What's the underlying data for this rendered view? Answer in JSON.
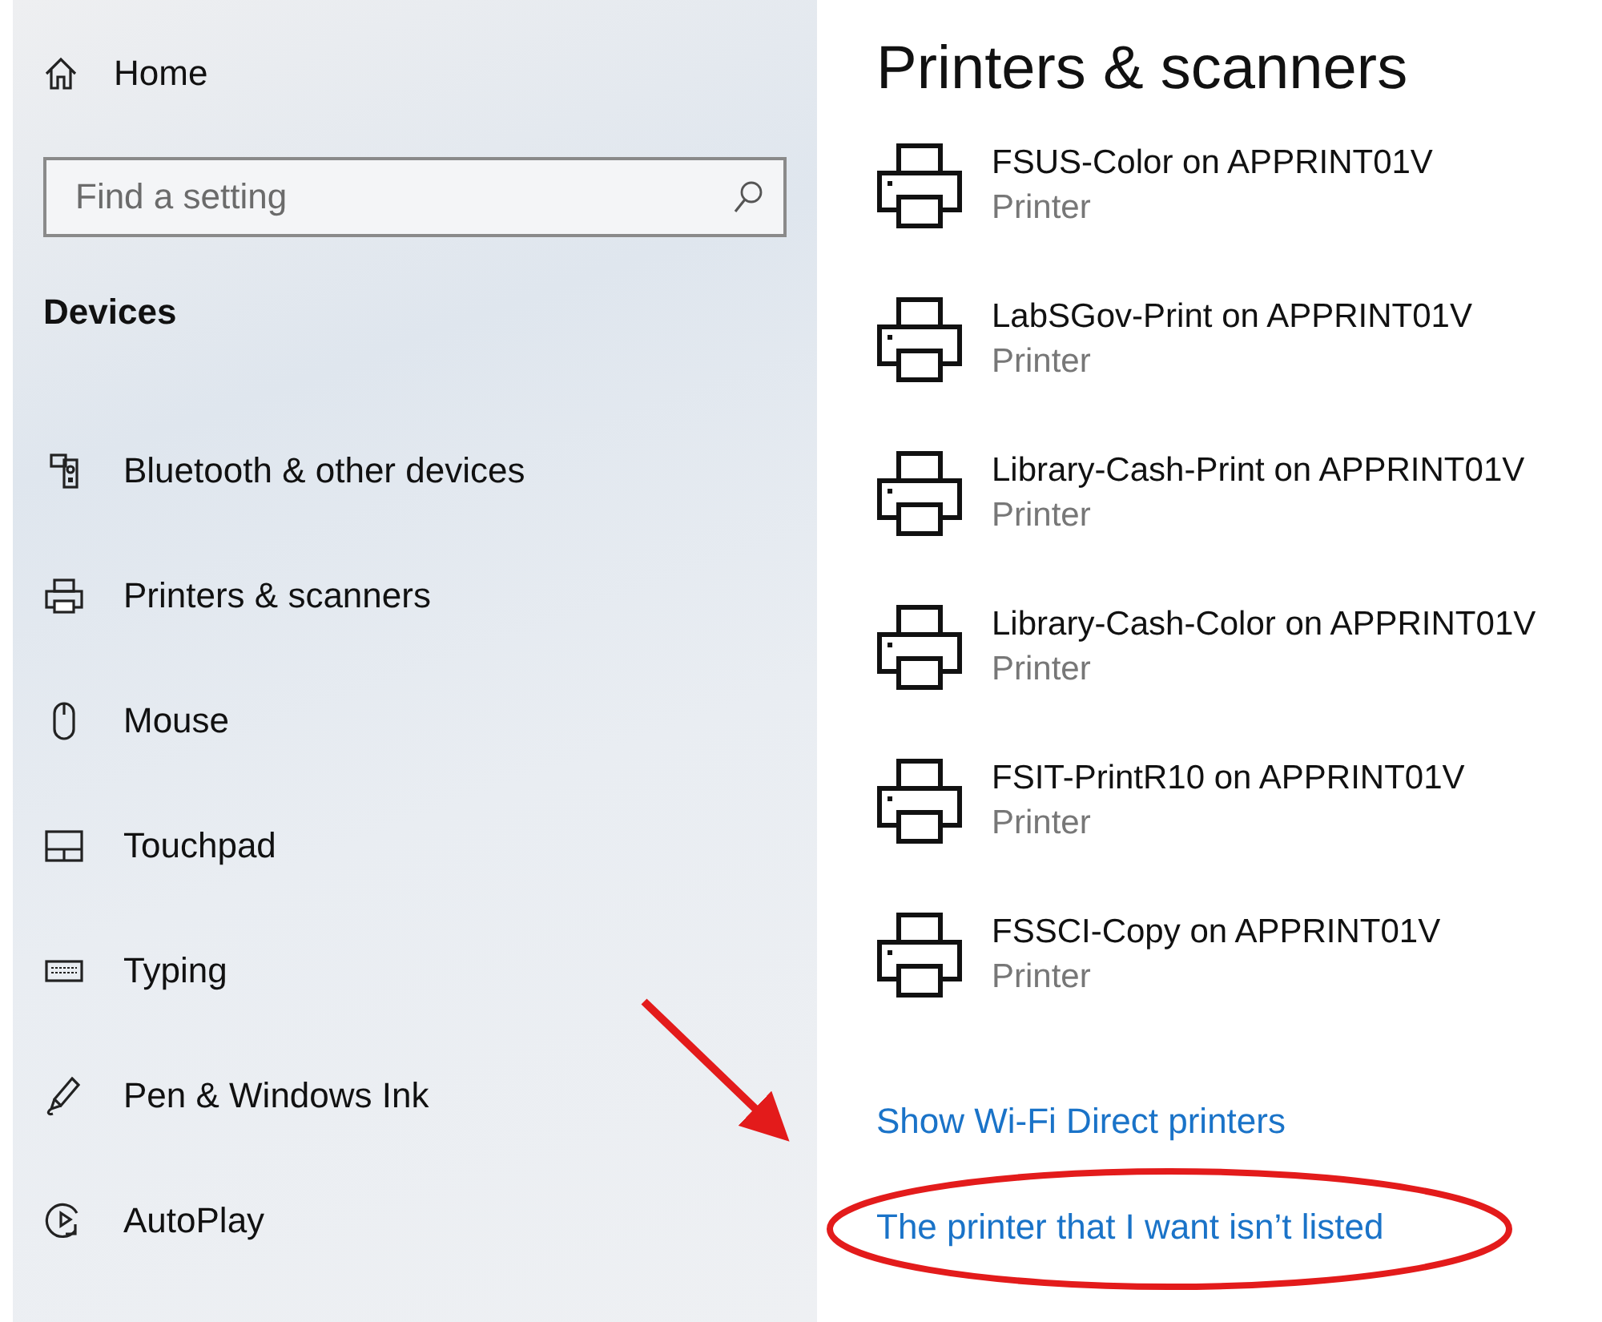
{
  "sidebar": {
    "home": "Home",
    "search": {
      "placeholder": "Find a setting"
    },
    "section": "Devices",
    "items": [
      {
        "label": "Bluetooth & other devices"
      },
      {
        "label": "Printers & scanners"
      },
      {
        "label": "Mouse"
      },
      {
        "label": "Touchpad"
      },
      {
        "label": "Typing"
      },
      {
        "label": "Pen & Windows Ink"
      },
      {
        "label": "AutoPlay"
      }
    ]
  },
  "main": {
    "title": "Printers & scanners",
    "printers": [
      {
        "name": "FSUS-Color on APPRINT01V",
        "type": "Printer"
      },
      {
        "name": "LabSGov-Print on APPRINT01V",
        "type": "Printer"
      },
      {
        "name": "Library-Cash-Print on APPRINT01V",
        "type": "Printer"
      },
      {
        "name": "Library-Cash-Color on APPRINT01V",
        "type": "Printer"
      },
      {
        "name": "FSIT-PrintR10 on APPRINT01V",
        "type": "Printer"
      },
      {
        "name": "FSSCI-Copy on APPRINT01V",
        "type": "Printer"
      }
    ],
    "links": [
      "Show Wi-Fi Direct printers",
      "The printer that I want isn’t listed"
    ]
  }
}
